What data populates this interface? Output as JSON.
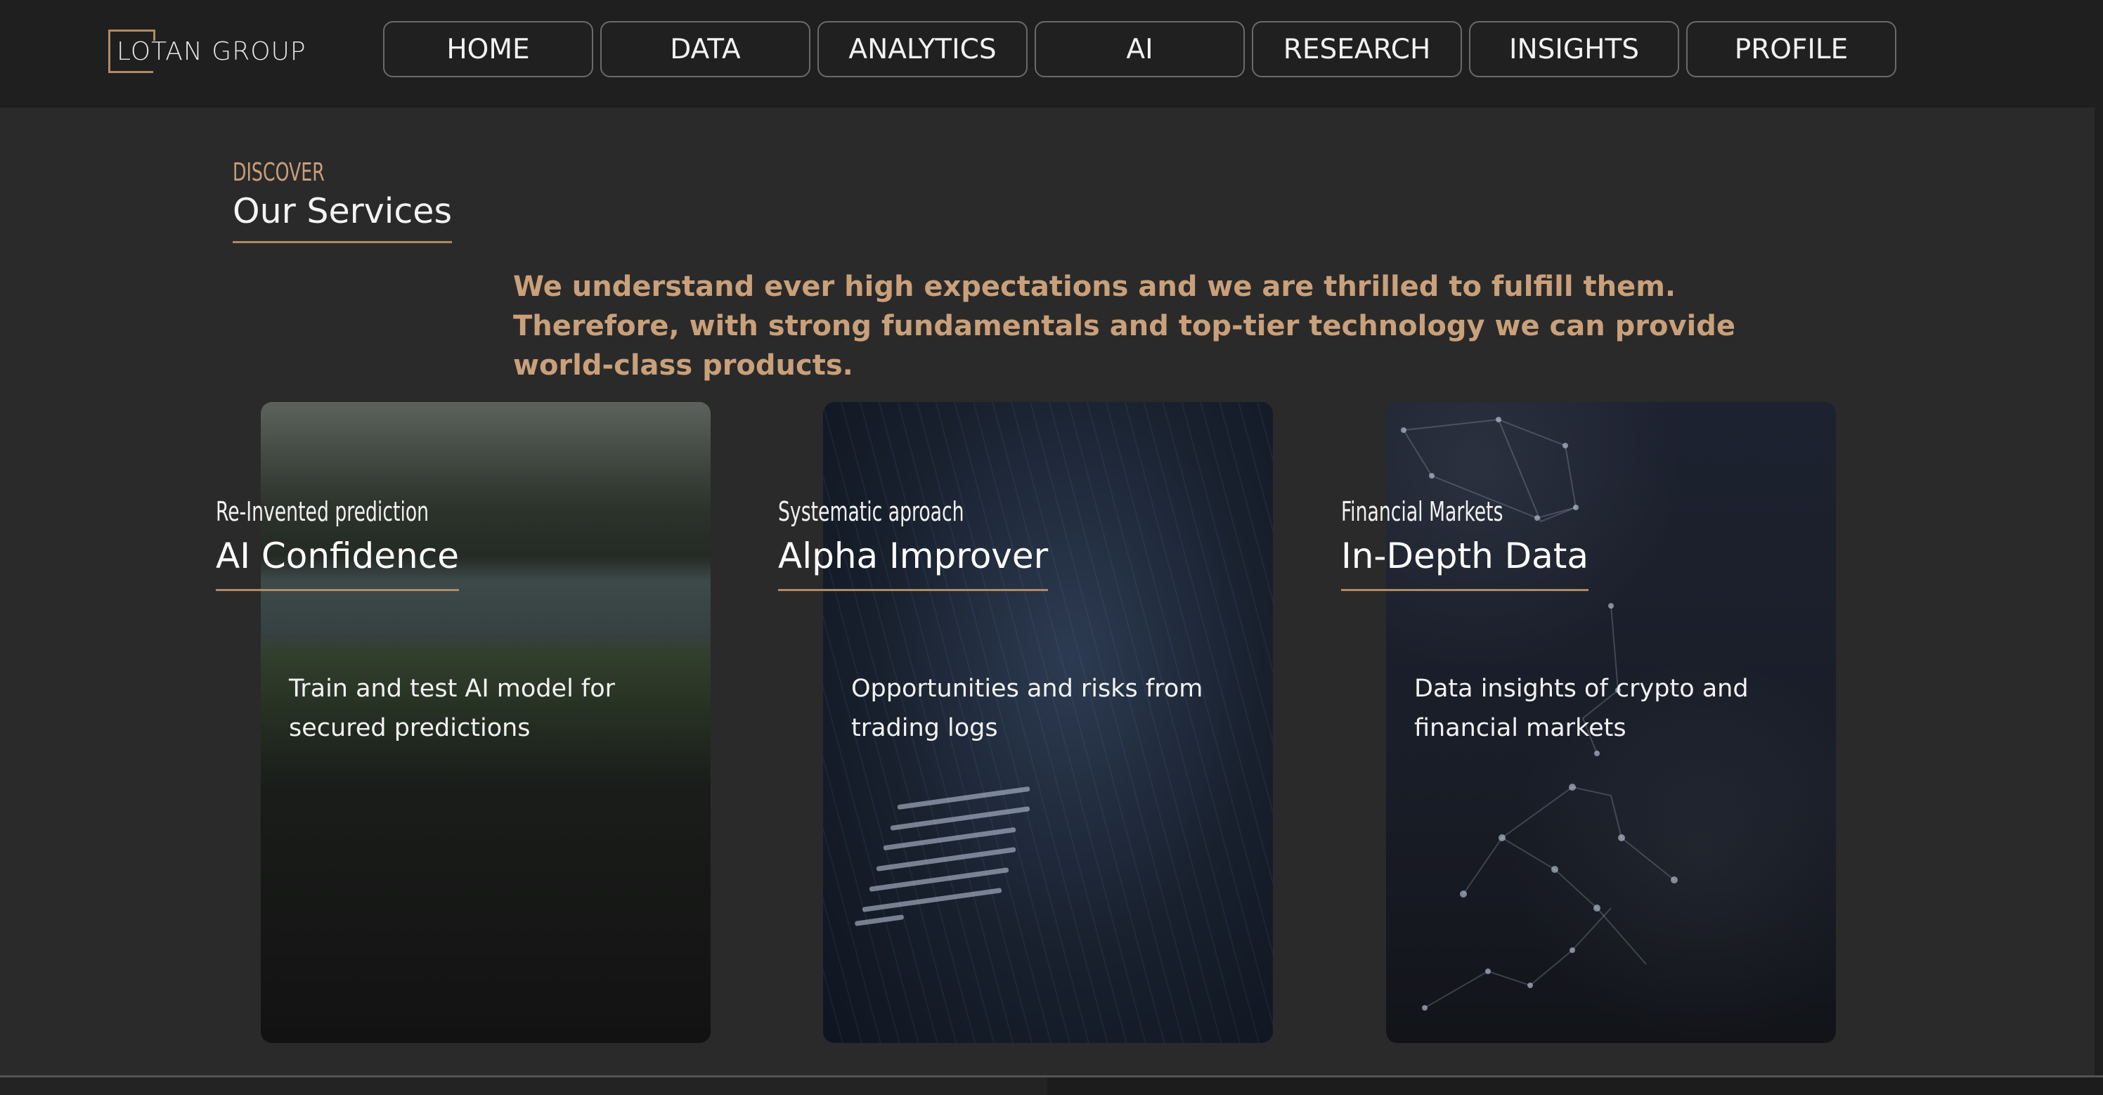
{
  "brand": {
    "logo_text": "LOTAN GROUP"
  },
  "nav": {
    "items": [
      {
        "label": "HOME"
      },
      {
        "label": "DATA"
      },
      {
        "label": "ANALYTICS"
      },
      {
        "label": "AI"
      },
      {
        "label": "RESEARCH"
      },
      {
        "label": "INSIGHTS"
      },
      {
        "label": "PROFILE"
      }
    ]
  },
  "section": {
    "eyebrow": "DISCOVER",
    "title": "Our Services",
    "intro": "We understand ever high expectations and we are thrilled to fulfill them. Therefore, with strong fundamentals and top-tier technology we can provide world-class products."
  },
  "cards": [
    {
      "subtitle": "Re-Invented prediction",
      "title": "AI Confidence",
      "description": "Train and test AI model for secured predictions"
    },
    {
      "subtitle": "Systematic aproach",
      "title": "Alpha Improver",
      "description": "Opportunities and risks from trading logs"
    },
    {
      "subtitle": "Financial Markets",
      "title": "In-Depth Data",
      "description": "Data insights of crypto and financial markets"
    }
  ],
  "colors": {
    "accent": "#c9a07a",
    "background": "#2a2a2a",
    "header": "#1f1f1f"
  }
}
